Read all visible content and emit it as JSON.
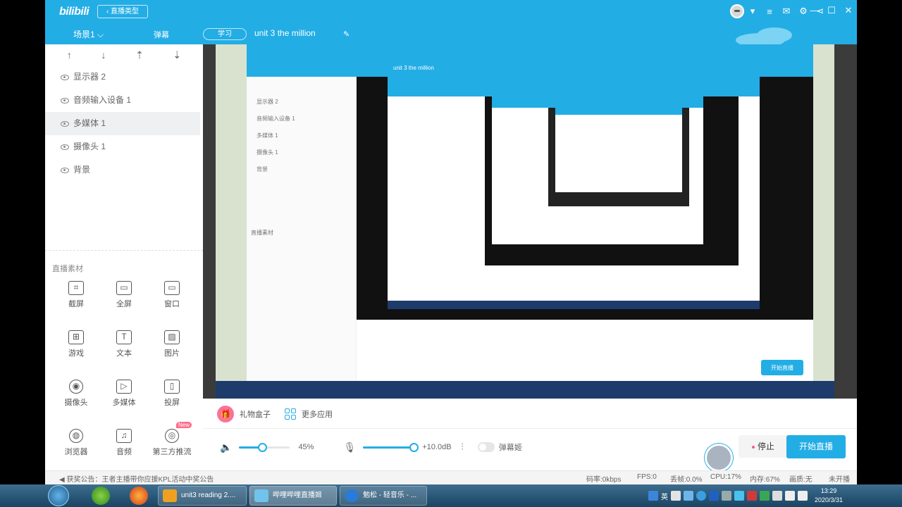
{
  "titlebar": {
    "logo": "bilibili",
    "live_type_button": "‹ 直播类型",
    "icons": [
      "avatar",
      "dropdown-icon",
      "menu-icon",
      "mail-icon",
      "gear-icon",
      "share-icon"
    ],
    "window_controls": [
      "minimize-icon",
      "maximize-icon",
      "close-icon"
    ]
  },
  "subbar": {
    "scene_tab": "场景1 ⌵",
    "danmu_tab": "弹幕",
    "category": "学习",
    "room_title": "unit 3 the million",
    "edit_icon": "edit-icon"
  },
  "sources": {
    "sort_icons": [
      "↑",
      "↓",
      "⇡",
      "⇣"
    ],
    "items": [
      {
        "label": "显示器 2",
        "active": false
      },
      {
        "label": "音频输入设备 1",
        "active": false
      },
      {
        "label": "多媒体 1",
        "active": true
      },
      {
        "label": "摄像头 1",
        "active": false
      },
      {
        "label": "背景",
        "active": false
      }
    ]
  },
  "materials": {
    "title": "直播素材",
    "items": [
      {
        "label": "截屏",
        "icon": "crop-icon",
        "glyph": "⌗"
      },
      {
        "label": "全屏",
        "icon": "monitor-icon",
        "glyph": "▭"
      },
      {
        "label": "窗口",
        "icon": "window-icon",
        "glyph": "▭"
      },
      {
        "label": "游戏",
        "icon": "gamepad-icon",
        "glyph": "⊞"
      },
      {
        "label": "文本",
        "icon": "text-icon",
        "glyph": "T"
      },
      {
        "label": "图片",
        "icon": "image-icon",
        "glyph": "▨"
      },
      {
        "label": "摄像头",
        "icon": "webcam-icon",
        "glyph": "◉"
      },
      {
        "label": "多媒体",
        "icon": "media-icon",
        "glyph": "▷"
      },
      {
        "label": "投屏",
        "icon": "phone-icon",
        "glyph": "▯"
      },
      {
        "label": "浏览器",
        "icon": "browser-icon",
        "glyph": "◍"
      },
      {
        "label": "音频",
        "icon": "music-icon",
        "glyph": "♫"
      },
      {
        "label": "第三方推流",
        "icon": "stream-icon",
        "glyph": "◎",
        "badge": "New"
      }
    ]
  },
  "preview_nested": {
    "nested_title": "unit 3 the million",
    "nested_sources": [
      "显示器 2",
      "音频输入设备 1",
      "多媒体 1",
      "摄像头 1",
      "背景"
    ],
    "nested_materials_title": "直播素材",
    "nested_start": "开始直播"
  },
  "controls": {
    "gift_label": "礼物盒子",
    "more_apps_label": "更多应用",
    "volume_value": "45%",
    "volume_level": 0.45,
    "mic_value": "+10.0dB",
    "mic_level": 1.0,
    "danmu_toggle_label": "弹幕姬",
    "stop_label": "停止",
    "start_label": "开始直播"
  },
  "status": {
    "notice": "获奖公告：王者主播带你应援KPL活动中奖公告",
    "bitrate": "码率:0kbps",
    "fps": "FPS:0",
    "drop": "丢帧:0.0%",
    "cpu": "CPU:17%",
    "mem": "内存:67%",
    "quality": "画质:无",
    "live_state": "未开播"
  },
  "taskbar": {
    "tasks": [
      {
        "label": "unit3 reading 2....",
        "color": "#f0a020"
      },
      {
        "label": "哔哩哔哩直播姬",
        "color": "#6fc3ec"
      },
      {
        "label": "勉松 - 轻音乐 - ...",
        "color": "#2a7bd6"
      }
    ],
    "ime": "英",
    "time": "13:29",
    "date": "2020/3/31"
  }
}
